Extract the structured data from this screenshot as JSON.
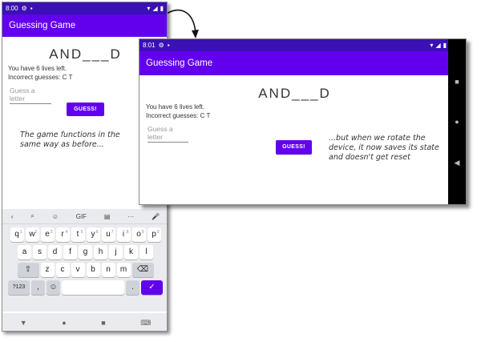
{
  "portrait": {
    "status": {
      "time": "8:00"
    },
    "appbar": {
      "title": "Guessing Game"
    },
    "game": {
      "word": "AND___D",
      "lives": "You have 6 lives left.",
      "incorrect": "Incorrect guesses: C T",
      "input_placeholder": "Guess a letter",
      "button_label": "GUESS!"
    },
    "note": "The game functions in the same way as before...",
    "keyboard": {
      "suggestions": [
        "‹",
        "⌕",
        "☺",
        "GIF",
        "▤",
        "···",
        "🎤"
      ],
      "row1": [
        {
          "k": "q",
          "s": "1"
        },
        {
          "k": "w",
          "s": "2"
        },
        {
          "k": "e",
          "s": "3"
        },
        {
          "k": "r",
          "s": "4"
        },
        {
          "k": "t",
          "s": "5"
        },
        {
          "k": "y",
          "s": "6"
        },
        {
          "k": "u",
          "s": "7"
        },
        {
          "k": "i",
          "s": "8"
        },
        {
          "k": "o",
          "s": "9"
        },
        {
          "k": "p",
          "s": "0"
        }
      ],
      "row2": [
        "a",
        "s",
        "d",
        "f",
        "g",
        "h",
        "j",
        "k",
        "l"
      ],
      "row3": [
        "c",
        "v",
        "b",
        "n",
        "m"
      ],
      "row3_first": "z",
      "shift": "⇧",
      "backspace": "⌫",
      "mode": "?123",
      "comma": ",",
      "emoji": "☺",
      "period": ".",
      "enter": "✓"
    },
    "navbar": {
      "back": "▼",
      "home": "●",
      "recents": "■",
      "kb": "⌨"
    }
  },
  "landscape": {
    "status": {
      "time": "8:01"
    },
    "appbar": {
      "title": "Guessing Game"
    },
    "game": {
      "word": "AND___D",
      "lives": "You have 6 lives left.",
      "incorrect": "Incorrect guesses: C T",
      "input_placeholder": "Guess a letter",
      "button_label": "GUESS!"
    },
    "note": "...but when we rotate the device, it now saves its state and doesn't get reset",
    "sidenav": {
      "recents": "■",
      "home": "●",
      "back": "◀"
    }
  },
  "colors": {
    "primary": "#6200ee",
    "status": "#3b10b5"
  }
}
